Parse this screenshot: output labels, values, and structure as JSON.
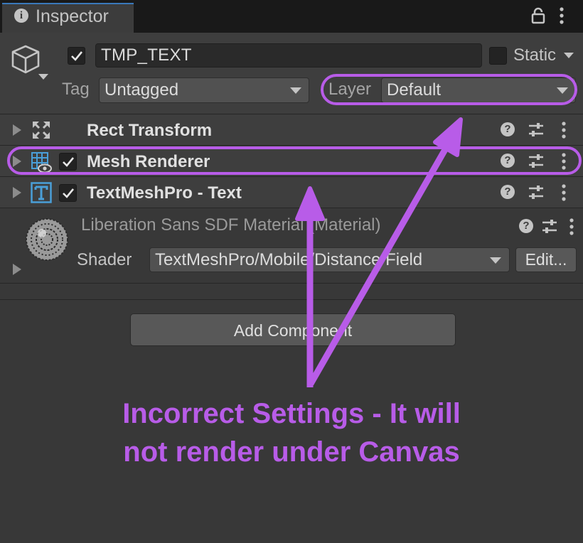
{
  "tab": {
    "title": "Inspector"
  },
  "header": {
    "object_name": "TMP_TEXT",
    "active_checked": true,
    "static_label": "Static",
    "tag_label": "Tag",
    "tag_value": "Untagged",
    "layer_label": "Layer",
    "layer_value": "Default"
  },
  "components": [
    {
      "title": "Rect Transform",
      "icon": "rect-transform-icon"
    },
    {
      "title": "Mesh Renderer",
      "icon": "mesh-renderer-icon",
      "enabled": true
    },
    {
      "title": "TextMeshPro - Text",
      "icon": "textmeshpro-icon",
      "enabled": true
    }
  ],
  "material": {
    "name": "Liberation Sans SDF Material (Material)",
    "shader_label": "Shader",
    "shader_value": "TextMeshPro/Mobile/Distance Field",
    "edit_label": "Edit..."
  },
  "add_component_label": "Add Component",
  "annotation": {
    "line1": "Incorrect Settings - It will",
    "line2": "not render under Canvas",
    "color": "#b85ce8"
  },
  "colors": {
    "highlight": "#b85ce8",
    "tab_accent": "#3a79bb",
    "tmp_icon": "#4a9fd8"
  }
}
